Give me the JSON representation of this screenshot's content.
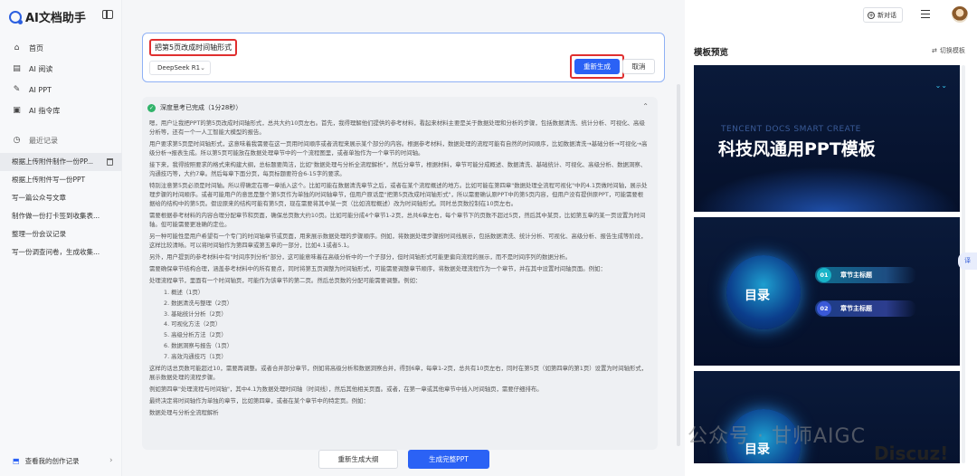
{
  "app": {
    "title": "AI文档助手"
  },
  "nav": [
    {
      "label": "首页",
      "icon": "home-icon"
    },
    {
      "label": "AI 阅读",
      "icon": "read-icon"
    },
    {
      "label": "AI PPT",
      "icon": "ppt-icon"
    },
    {
      "label": "AI 指令库",
      "icon": "command-library-icon"
    }
  ],
  "recent": {
    "label": "最近记录",
    "items": [
      "根据上传附件制作一份PP...",
      "根据上传附件写一份PPT",
      "写一篇公众号文章",
      "制作做一份打卡签到收集表...",
      "整理一份会议记录",
      "写一份调查问卷，生成收集..."
    ]
  },
  "my_records": "查看我的创作记录",
  "prompt": {
    "text": "把第5页改成时间轴形式",
    "model": "DeepSeek R1",
    "regenerate": "重新生成",
    "cancel": "取消"
  },
  "thinking": {
    "status": "深度思考已完成（1分28秒）",
    "paragraphs": [
      "嗯，用户让我把PPT的第5页改成时间轴形式，总共大约10页左右。首先，我得理解他们提供的参考材料，看起来材料主要是关于数据处理和分析的步骤，包括数据清洗、统计分析、可视化、高级分析等，还有一个一人工智能大模型的报告。",
      "用户要求第5页是时间轴形式，这意味着我需要在这一页用时间顺序或者流程来展示某个部分的内容。根据参考材料，数据处理的流程可能有自然的时间顺序，比如数据清洗→基础分析→可视化→高级分析→报表生成。所以第5页可能放在数据处理章节中的一个流程图里，或者单独作为一个章节的时间轴。",
      "接下来，我得按照要求的格式来构建大纲，总标题要简洁，比如\"数据处理与分析全流程解析\"，然后分章节，根据材料，章节可能分成概述、数据清洗、基础统计、可视化、高级分析、数据洞察、沟通技巧等，大约7章。然后每章下面分页，每页标题要符合6-15字的要求。",
      "特别注意第5页必须是时间轴。所以得确定在哪一章插入这个。比如可能在数据清洗章节之后，或者在某个流程概述的地方。比如可能在第四章\"数据处理全流程可视化\"中的4.1页做时间轴，展示处理步骤的时间顺序。或者可能用户的意思是整个第5页作为单独的时间轴章节，但用户原话是\"把第5页改成时间轴形式\"，所以需要确认原PPT中的第5页内容，但用户没有提供原PPT，可能需要根据给的结构中的第5页。假设原来的结构可能有第5页，现在需要将其中某一页（比如流程概述）改为时间轴形式。同时总页数控制在10页左右。",
      "需要根据参考材料的内容合理分配章节和页面，确保总页数大约10页。比如可能分成4个章节1-2页，总共6章左右，每个章节下的页数不超过5页，然后其中某页，比如第五章的某一页设置为时间轴。但可能需要更准确的定位。",
      "另一种可能性是用户希望有一个专门的时间轴章节或页面，用来展示数据处理的步骤顺序。例如，将数据处理步骤按时间线展示，包括数据清洗、统计分析、可视化、高级分析、报告生成等阶段，这样比较清晰。可以将时间轴作为第四章或第五章的一部分，比如4.1或者5.1。",
      "另外，用户提到的参考材料中有\"时间序列分析\"部分，这可能意味着在高级分析中的一个子部分，但时间轴形式可能更偏向流程的展示，而不是时间序列的数据分析。",
      "需要确保章节结构合理，涵盖参考材料中的所有要点，同时将第五页调整为时间轴形式，可能需要调整章节顺序，将数据处理流程作为一个章节，并在其中设置时间轴页面。例如：",
      "处理流程章节，里面有一个时间轴页，可能作为该章节的第二页。然后总页数的分配可能需要调整。例如：",
      "这样的话总页数可能超过10，需要再调整。或者合并部分章节，例如将高级分析和数据洞察合并，得到6章，每章1-2页，总共有10页左右，同时在第5页（如第四章的第1页）设置为时间轴形式，展示数据处理的流程步骤。",
      "例如第四章\"处理流程与时间轴\"，其中4.1为数据处理时间轴（时间线），然后其他相关页面。或者，在第一章或其他章节中插入时间轴页，需要仔细排布。",
      "最终决定将时间轴作为单独的章节，比如第四章，或者在某个章节中的特定页。例如：",
      "数据处理与分析全流程解析"
    ],
    "outline": [
      "1. 概述（1页）",
      "2. 数据清洗与整理（2页）",
      "3. 基础统计分析（2页）",
      "4. 可视化方法（2页）",
      "5. 高级分析方法（2页）",
      "6. 数据洞察与报告（1页）",
      "7. 高效沟通技巧（1页）"
    ]
  },
  "actions": {
    "rebuild": "重新生成大纲",
    "generate": "生成完整PPT"
  },
  "header": {
    "new_chat": "新对话"
  },
  "preview": {
    "title": "模板预览",
    "switch": "切换模板",
    "slide1_sub": "TENCENT DOCS SMART CREATE",
    "slide1_title": "科技风通用PPT模板",
    "toc_label": "目录",
    "chapter1_num": "01",
    "chapter1": "章节主标题",
    "chapter2_num": "02",
    "chapter2": "章节主标题"
  },
  "float_tab": "译",
  "watermark": "公众号 · 甘师AIGC",
  "discuz": "Discuz!",
  "colors": {
    "accent": "#2b62f5",
    "highlight_box": "#e02f2f",
    "slide_bg": "#0a1a3a"
  }
}
